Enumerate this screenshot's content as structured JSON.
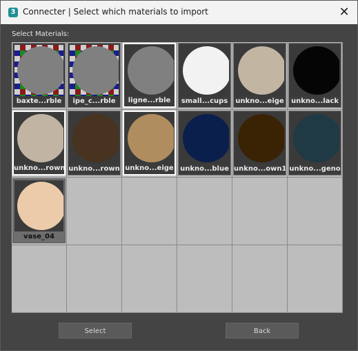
{
  "window": {
    "title": "Connecter | Select which materials to import",
    "app_icon_glyph": "3",
    "close_glyph": "✕"
  },
  "section_label": "Select Materials:",
  "materials": [
    {
      "label": "baxte...rble",
      "swatch": "#808080",
      "pattern": "checker",
      "selected": false
    },
    {
      "label": "ipe_c...rble",
      "swatch": "#808080",
      "pattern": "checker",
      "selected": false
    },
    {
      "label": "ligne...rble",
      "swatch": "#808080",
      "pattern": "none",
      "selected": true
    },
    {
      "label": "small...cups",
      "swatch": "#f2f2f2",
      "pattern": "none",
      "selected": false
    },
    {
      "label": "unkno...eige",
      "swatch": "#c2b5a2",
      "pattern": "none",
      "selected": false
    },
    {
      "label": "unkno...lack",
      "swatch": "#050505",
      "pattern": "none",
      "selected": false
    },
    {
      "label": "unkno...rown",
      "swatch": "#c1b4a2",
      "pattern": "none",
      "selected": true
    },
    {
      "label": "unkno...rown",
      "swatch": "#47331f",
      "pattern": "none",
      "selected": false
    },
    {
      "label": "unkno...eige",
      "swatch": "#b08d5f",
      "pattern": "none",
      "selected": true
    },
    {
      "label": "unkno...blue",
      "swatch": "#0b1f4d",
      "pattern": "none",
      "selected": false
    },
    {
      "label": "unkno...own1",
      "swatch": "#3a2205",
      "pattern": "none",
      "selected": false
    },
    {
      "label": "unkno...geno",
      "swatch": "#1f3a45",
      "pattern": "none",
      "selected": false
    },
    {
      "label": "vase_04",
      "swatch": "#eccbab",
      "pattern": "none",
      "selected": false,
      "style": "plain"
    }
  ],
  "grid": {
    "columns": 6,
    "rows": 4
  },
  "buttons": {
    "select": "Select",
    "back": "Back"
  }
}
